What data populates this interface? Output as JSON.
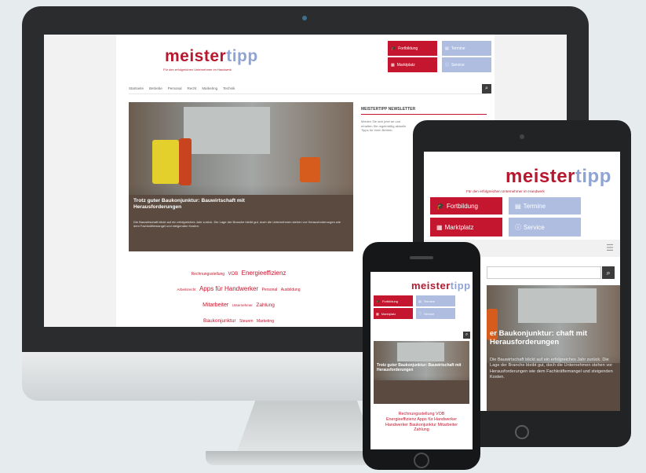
{
  "brand": {
    "name_a": "meister",
    "name_b": "tipp",
    "tagline": "Für den erfolgreichen Unternehmer im Handwerk"
  },
  "colors": {
    "accent_red": "#c4162e",
    "accent_blue": "#aebde0",
    "device_dark": "#2b2c2e"
  },
  "desktop": {
    "buttons": {
      "fortbildung": "Fortbildung",
      "marktplatz": "Marktplatz",
      "termine": "Termine",
      "extra": "Service"
    },
    "nav_items": [
      "Startseite",
      "Betriebe",
      "Personal",
      "Recht",
      "Marketing",
      "Technik"
    ],
    "hero": {
      "title": "Trotz guter Baukonjunktur: Bauwirtschaft mit Herausforderungen",
      "text": "Die Bauwirtschaft blickt auf ein erfolgreiches Jahr zurück. Die Lage der Branche bleibt gut, doch die Unternehmen stehen vor Herausforderungen wie dem Fachkräftemangel und steigenden Kosten."
    },
    "sidebar": {
      "heading": "MEISTERTIPP NEWSLETTER",
      "text": "Melden Sie sich jetzt an und erhalten Sie regelmäßig aktuelle Tipps für Ihren Betrieb."
    },
    "tag_cloud": [
      "Rechnungsstellung",
      "VOB",
      "Energieeffizienz",
      "Arbeitsrecht",
      "Apps für Handwerker",
      "Personal",
      "Ausbildung",
      "Mitarbeiter",
      "Unternehmer",
      "Zahlung",
      "Baukonjunktur",
      "Steuern",
      "Marketing"
    ]
  },
  "tablet": {
    "buttons": {
      "fortbildung": "Fortbildung",
      "marktplatz": "Marktplatz",
      "termine": "Termine",
      "service": "Service"
    },
    "hero_title": "er Baukonjunktur: chaft mit Herausforderungen",
    "hero_text": "Die Bauwirtschaft blickt auf ein erfolgreiches Jahr zurück. Die Lage der Branche bleibt gut, doch die Unternehmen stehen vor Herausforderungen wie dem Fachkräftemangel und steigenden Kosten."
  },
  "phone": {
    "buttons": {
      "fortbildung": "Fortbildung",
      "marktplatz": "Marktplatz",
      "termine": "Termine",
      "service": "Service"
    },
    "hero_title": "Trotz guter Baukonjunktur: Bauwirtschaft mit Herausforderungen",
    "tag_cloud": "Rechnungsstellung VOB Energieeffizienz Apps für Handwerker Handwerker Baukonjunktur Mitarbeiter Zahlung"
  }
}
